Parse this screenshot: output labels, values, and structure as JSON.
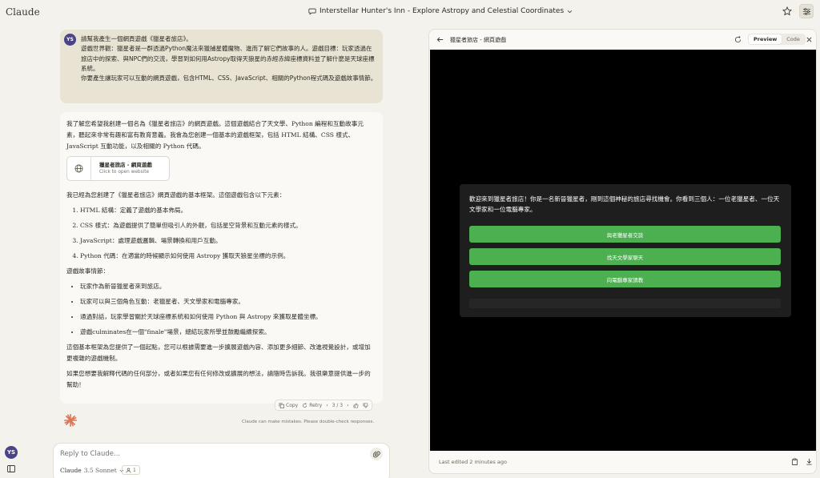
{
  "app": {
    "brand": "Claude"
  },
  "chat": {
    "title": "Interstellar Hunter's Inn - Explore Astropy and Celestial Coordinates"
  },
  "user": {
    "initials": "YS"
  },
  "user_message": {
    "lines": [
      "請幫我產生一個網頁遊戲《獵星者旅店》。",
      "遊戲世界觀：獵星者是一群透過Python魔法來獵捕星體魔物、進而了解它們故事的人。遊戲目標：玩家透過在旅店中的探索、與NPC們的交流，學習到如何用Astropy取得天狼星的赤經赤緯座標資料並了解什麼是天球座標系統。",
      "你要產生讓玩家可以互動的網頁遊戲，包含HTML、CSS、JavaScript、相關的Python程式碼及遊戲故事情節。"
    ]
  },
  "ai_message": {
    "intro": "我了解您希望我創建一個名為《獵星者旅店》的網頁遊戲。這個遊戲結合了天文學、Python 編程和互動故事元素，聽起來非常有趣和富有教育意義。我會為您創建一個基本的遊戲框架，包括 HTML 結構、CSS 樣式、JavaScript 互動功能，以及相關的 Python 代碼。",
    "artifact_card": {
      "title": "獵星者旅店 - 網頁遊戲",
      "subtitle": "Click to open website"
    },
    "framework_intro": "我已經為您創建了《獵星者旅店》網頁遊戲的基本框架。這個遊戲包含以下元素：",
    "steps": [
      "HTML 結構：定義了遊戲的基本佈局。",
      "CSS 樣式：為遊戲提供了簡單但吸引人的外觀，包括星空背景和互動元素的樣式。",
      "JavaScript：處理遊戲邏輯、場景轉換和用戶互動。",
      "Python 代碼：在適當的時候顯示如何使用 Astropy 獲取天狼星坐標的示例。"
    ],
    "story_heading": "遊戲故事情節：",
    "story": [
      "玩家作為新晉獵星者來到旅店。",
      "玩家可以與三個角色互動：老獵星者、天文學家和電腦專家。",
      "通過對話，玩家學習關於天球座標系統和如何使用 Python 與 Astropy 來獲取星體坐標。",
      "遊戲culminates在一個\"finale\"場景，總結玩家所學並鼓勵繼續探索。"
    ],
    "closing_1": "這個基本框架為您提供了一個起點，您可以根據需要進一步擴展遊戲內容、添加更多細節、改進視覺設計，或增加更複雜的遊戲機制。",
    "closing_2": "如果您想要我解釋代碼的任何部分，或者如果您有任何修改或擴展的想法，請隨時告訴我。我很樂意提供進一步的幫助！"
  },
  "message_actions": {
    "copy": "Copy",
    "retry": "Retry",
    "pager": "3 / 3"
  },
  "disclaimer": "Claude can make mistakes. Please double-check responses.",
  "composer": {
    "placeholder": "Reply to Claude...",
    "model": "Claude",
    "model_version": "3.5 Sonnet",
    "style_count": "1"
  },
  "artifact": {
    "title": "獵星者旅店 - 網頁遊戲",
    "tabs": {
      "preview": "Preview",
      "code": "Code"
    },
    "last_edited": "Last edited 2 minutes ago",
    "game": {
      "intro": "歡迎來到獵星者旅店！你是一名新晉獵星者，剛到這個神秘的旅店尋找機會。你看到三個人：一位老獵星者、一位天文學家和一位電腦專家。",
      "buttons": [
        "與老獵星者交談",
        "找天文學家聊天",
        "向電腦專家請教"
      ]
    }
  },
  "colors": {
    "game_button": "#4caf50",
    "avatar": "#4a4388",
    "claude_logo": "#d97757"
  }
}
